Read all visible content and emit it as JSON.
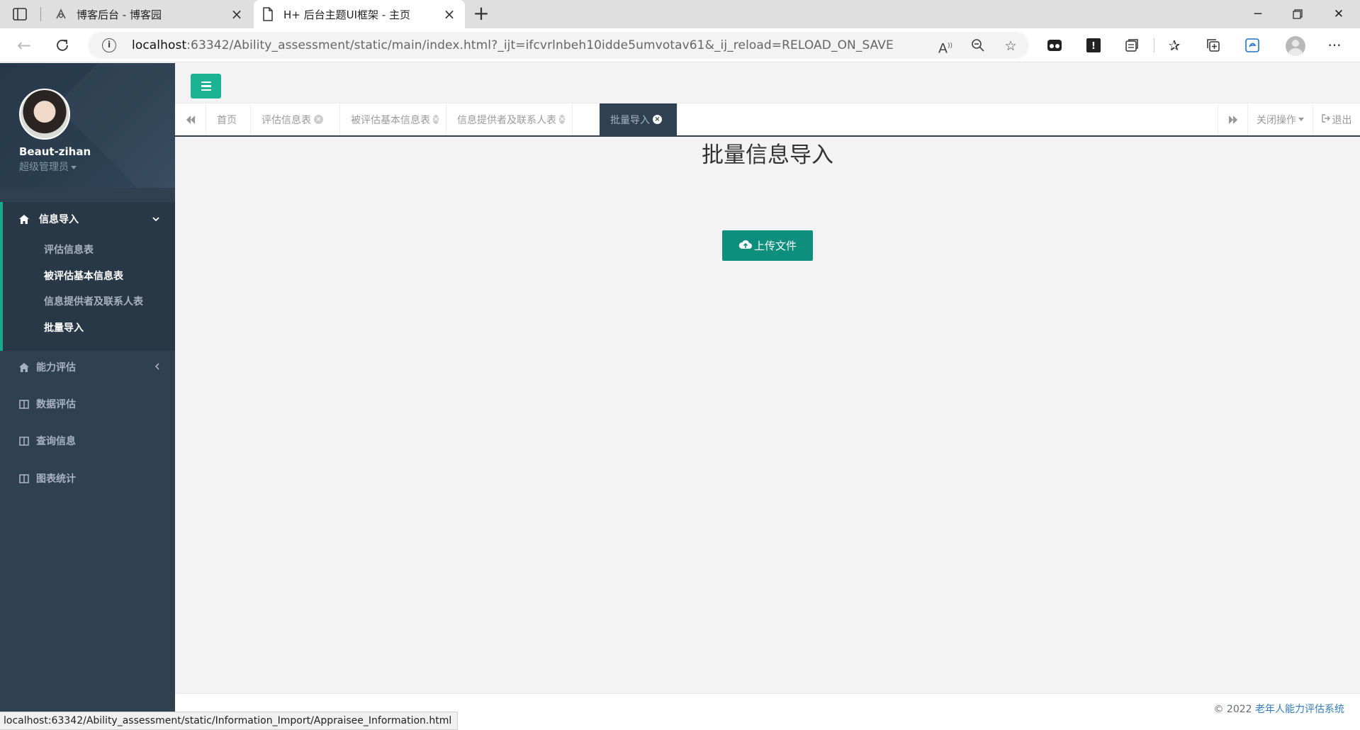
{
  "browser": {
    "tabs": [
      {
        "title": "博客后台 - 博客园",
        "icon": "blog-icon"
      },
      {
        "title": "H+ 后台主题UI框架 - 主页",
        "icon": "page-icon"
      }
    ],
    "address": {
      "host": "localhost",
      "rest": ":63342/Ability_assessment/static/main/index.html?_ijt=ifcvrlnbeh10idde5umvotav61&_ij_reload=RELOAD_ON_SAVE"
    },
    "status_url": "localhost:63342/Ability_assessment/static/Information_Import/Appraisee_Information.html"
  },
  "sidebar": {
    "user": {
      "name": "Beaut-zihan",
      "role": "超级管理员"
    },
    "menu": [
      {
        "label": "信息导入",
        "icon": "home-icon",
        "expanded": true
      },
      {
        "label": "能力评估",
        "icon": "home-icon"
      },
      {
        "label": "数据评估",
        "icon": "columns-icon"
      },
      {
        "label": "查询信息",
        "icon": "columns-icon"
      },
      {
        "label": "图表统计",
        "icon": "columns-icon"
      }
    ],
    "submenu": [
      "评估信息表",
      "被评估基本信息表",
      "信息提供者及联系人表",
      "批量导入"
    ]
  },
  "content_tabs": {
    "items": [
      "首页",
      "评估信息表",
      "被评估基本信息表",
      "信息提供者及联系人表",
      "批量导入"
    ],
    "active": "批量导入",
    "close_ops": "关闭操作",
    "logout": "退出"
  },
  "main": {
    "title": "批量信息导入",
    "upload_label": "上传文件"
  },
  "footer": {
    "copyright": "© 2022 ",
    "system_name": "老年人能力评估系统"
  },
  "colors": {
    "sidebar": "#2f4050",
    "accent": "#1ab394",
    "upload_button": "#0e8f7e"
  }
}
